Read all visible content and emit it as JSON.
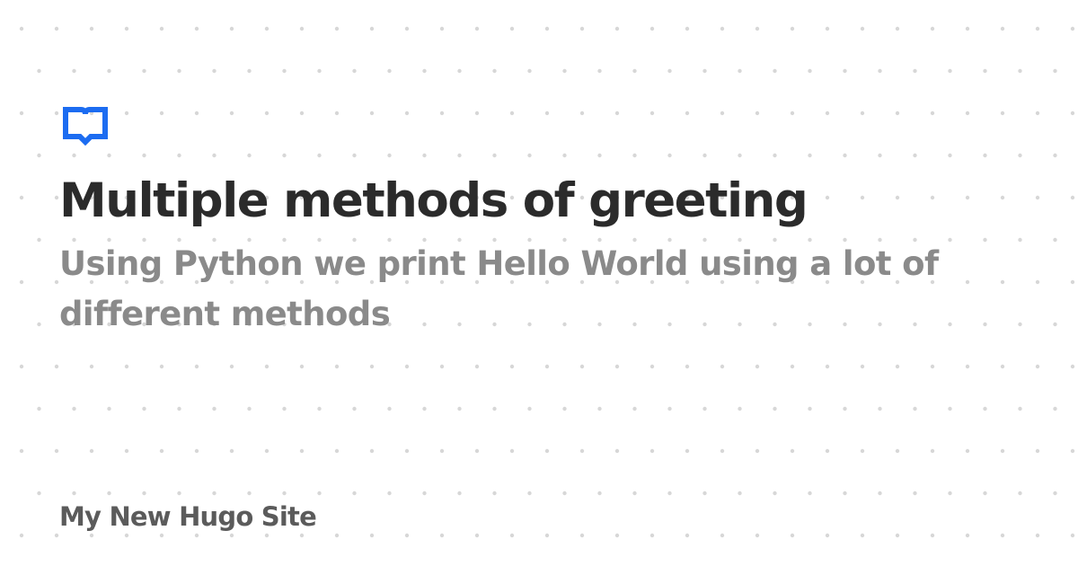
{
  "card": {
    "title": "Multiple methods of greeting",
    "subtitle": "Using Python we print Hello World using a lot of different methods",
    "site_name": "My New Hugo Site"
  },
  "icons": {
    "logo": "book-icon"
  },
  "colors": {
    "background": "#ffffff",
    "title": "#2b2b2b",
    "subtitle": "#8a8a8a",
    "site_name": "#5b5b5b",
    "accent": "#1c6cf1",
    "dots": "#d7d7d7"
  }
}
